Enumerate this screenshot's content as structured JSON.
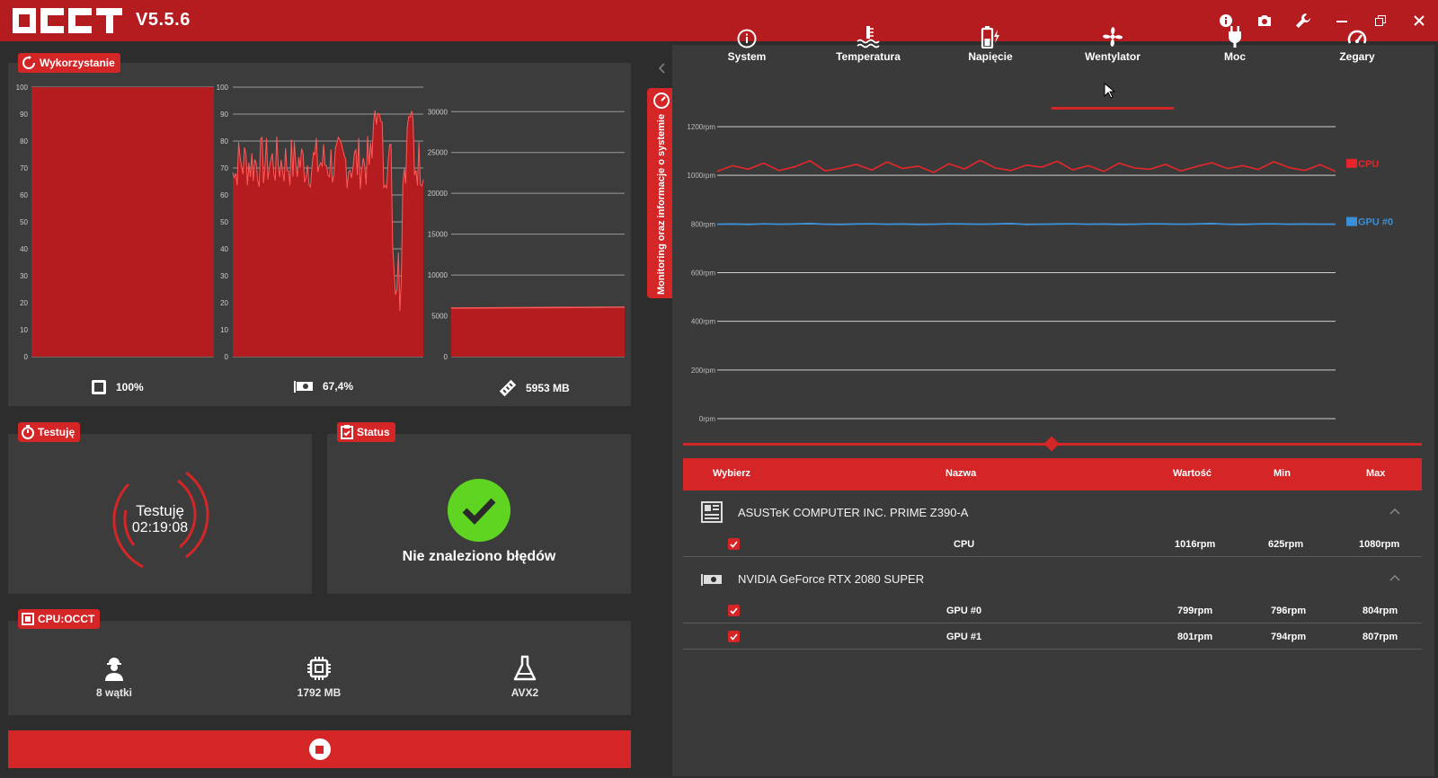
{
  "app": {
    "version": "V5.5.6",
    "logo_text": "OCCT"
  },
  "window_controls": [
    "info-icon",
    "camera-icon",
    "wrench-icon",
    "minimize-icon",
    "restore-icon",
    "close-icon"
  ],
  "usage_panel": {
    "tag": "Wykorzystanie",
    "cpu_label": "100%",
    "gpu_label": "67,4%",
    "ram_label": "5953 MB",
    "cpu_chart": {
      "ymax": 100,
      "ticks": [
        "100",
        "90",
        "80",
        "70",
        "60",
        "50",
        "40",
        "30",
        "20",
        "10",
        "0"
      ],
      "value": 100
    },
    "gpu_chart": {
      "ymax": 100,
      "ticks": [
        "100",
        "90",
        "80",
        "70",
        "60",
        "50",
        "40",
        "30",
        "20",
        "10",
        "0"
      ]
    },
    "ram_chart": {
      "ymax": 33000,
      "ticks": [
        "30000",
        "25000",
        "20000",
        "15000",
        "10000",
        "5000",
        "0"
      ],
      "value": 5953
    }
  },
  "testing_panel": {
    "tag": "Testuję",
    "status_text": "Testuję",
    "elapsed": "02:19:08"
  },
  "status_panel": {
    "tag": "Status",
    "message": "Nie znaleziono błędów"
  },
  "cpu_panel": {
    "tag": "CPU:OCCT",
    "threads": "8 wątki",
    "memory": "1792 MB",
    "instruction_set": "AVX2"
  },
  "side_tab": {
    "label": "Monitoring oraz informacje o systemie"
  },
  "tabs": [
    {
      "label": "System",
      "icon": "info-circle-icon"
    },
    {
      "label": "Temperatura",
      "icon": "thermometer-icon"
    },
    {
      "label": "Napięcie",
      "icon": "battery-bolt-icon"
    },
    {
      "label": "Wentylator",
      "icon": "fan-icon",
      "active": true
    },
    {
      "label": "Moc",
      "icon": "plug-icon"
    },
    {
      "label": "Zegary",
      "icon": "gauge-icon"
    }
  ],
  "chart_data": {
    "type": "line",
    "ylim": [
      0,
      1200
    ],
    "y_ticks": [
      "1200rpm",
      "1000rpm",
      "800rpm",
      "600rpm",
      "400rpm",
      "200rpm",
      "0rpm"
    ],
    "series": [
      {
        "name": "CPU",
        "color": "#e8262a",
        "values": [
          1016,
          1040,
          1025,
          1050,
          1020,
          1035,
          1060,
          1018,
          1030,
          1045,
          1022,
          1055,
          1028,
          1038,
          1012,
          1048,
          1026,
          1062,
          1030,
          1020,
          1042,
          1034,
          1058,
          1022,
          1040,
          1016,
          1050,
          1030,
          1025,
          1045,
          1018,
          1036,
          1052,
          1028,
          1040,
          1024,
          1056,
          1032,
          1020,
          1044,
          1016
        ]
      },
      {
        "name": "GPU #0",
        "color": "#3a8fd6",
        "values": [
          799,
          800,
          798,
          801,
          799,
          800,
          802,
          799,
          798,
          800,
          801,
          799,
          800,
          798,
          799,
          801,
          800,
          799,
          800,
          802,
          798,
          799,
          800,
          801,
          799,
          800,
          798,
          799,
          801,
          800,
          799,
          800,
          802,
          799,
          798,
          800,
          801,
          799,
          800,
          799,
          799
        ]
      }
    ]
  },
  "table": {
    "headers": {
      "select": "Wybierz",
      "name": "Nazwa",
      "value": "Wartość",
      "min": "Min",
      "max": "Max"
    },
    "groups": [
      {
        "name": "ASUSTeK COMPUTER INC. PRIME Z390-A",
        "rows": [
          {
            "name": "CPU",
            "value": "1016rpm",
            "min": "625rpm",
            "max": "1080rpm"
          }
        ]
      },
      {
        "name": "NVIDIA GeForce RTX 2080 SUPER",
        "rows": [
          {
            "name": "GPU #0",
            "value": "799rpm",
            "min": "796rpm",
            "max": "804rpm"
          },
          {
            "name": "GPU #1",
            "value": "801rpm",
            "min": "794rpm",
            "max": "807rpm"
          }
        ]
      }
    ]
  },
  "colors": {
    "accent": "#d42527",
    "titlebar": "#b51c1f",
    "ok_green": "#5fd522",
    "gpu_line": "#3a8fd6"
  }
}
